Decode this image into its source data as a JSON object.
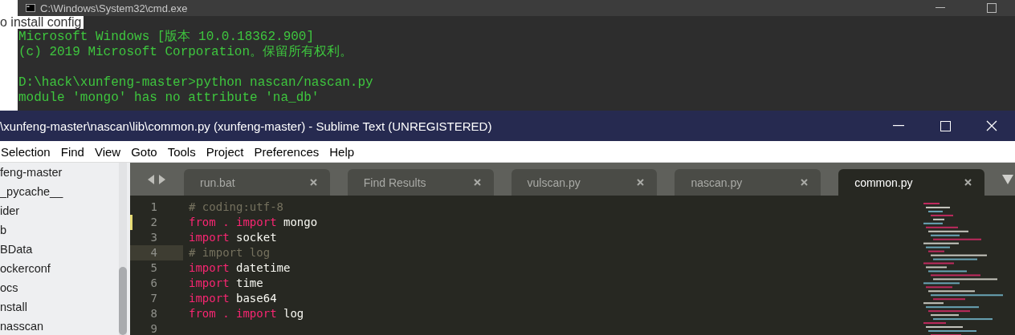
{
  "background_page": {
    "text": "o install config"
  },
  "console_window": {
    "title": "C:\\Windows\\System32\\cmd.exe",
    "lines": [
      {
        "kind": "text",
        "text": "Microsoft Windows [版本 10.0.18362.900]"
      },
      {
        "kind": "text",
        "text": "(c) 2019 Microsoft Corporation。保留所有权利。"
      },
      {
        "kind": "blank"
      },
      {
        "kind": "text",
        "text": "D:\\hack\\xunfeng-master>python nascan/nascan.py"
      },
      {
        "kind": "text",
        "text": "module 'mongo' has no attribute 'na_db'"
      }
    ]
  },
  "editor_window": {
    "title": "\\xunfeng-master\\nascan\\lib\\common.py (xunfeng-master) - Sublime Text (UNREGISTERED)",
    "menu": [
      "Selection",
      "Find",
      "View",
      "Goto",
      "Tools",
      "Project",
      "Preferences",
      "Help"
    ],
    "sidebar": {
      "items": [
        "feng-master",
        "_pycache__",
        "ider",
        "b",
        "BData",
        "ockerconf",
        "ocs",
        "nstall",
        "nasscan"
      ]
    },
    "tabs": [
      {
        "label": "run.bat",
        "selected": false
      },
      {
        "label": "Find Results",
        "selected": false
      },
      {
        "label": "vulscan.py",
        "selected": false
      },
      {
        "label": "nascan.py",
        "selected": false
      },
      {
        "label": "common.py",
        "selected": true
      }
    ],
    "code": [
      {
        "number": "1",
        "modified": false,
        "current": false,
        "tokens": [
          {
            "kind": "comment",
            "text": "# coding:utf-8"
          }
        ]
      },
      {
        "number": "2",
        "modified": true,
        "current": false,
        "tokens": [
          {
            "kind": "keyword",
            "text": "from . import"
          },
          {
            "kind": "plain",
            "text": " mongo"
          }
        ]
      },
      {
        "number": "3",
        "modified": false,
        "current": false,
        "tokens": [
          {
            "kind": "keyword",
            "text": "import"
          },
          {
            "kind": "plain",
            "text": " socket"
          }
        ]
      },
      {
        "number": "4",
        "modified": false,
        "current": true,
        "tokens": [
          {
            "kind": "comment",
            "text": "# import log"
          }
        ]
      },
      {
        "number": "5",
        "modified": false,
        "current": false,
        "tokens": [
          {
            "kind": "keyword",
            "text": "import"
          },
          {
            "kind": "plain",
            "text": " datetime"
          }
        ]
      },
      {
        "number": "6",
        "modified": false,
        "current": false,
        "tokens": [
          {
            "kind": "keyword",
            "text": "import"
          },
          {
            "kind": "plain",
            "text": " time"
          }
        ]
      },
      {
        "number": "7",
        "modified": false,
        "current": false,
        "tokens": [
          {
            "kind": "keyword",
            "text": "import"
          },
          {
            "kind": "plain",
            "text": " base64"
          }
        ]
      },
      {
        "number": "8",
        "modified": false,
        "current": false,
        "tokens": [
          {
            "kind": "keyword",
            "text": "from . import"
          },
          {
            "kind": "plain",
            "text": " log"
          }
        ]
      },
      {
        "number": "9",
        "modified": false,
        "current": false
      }
    ]
  }
}
